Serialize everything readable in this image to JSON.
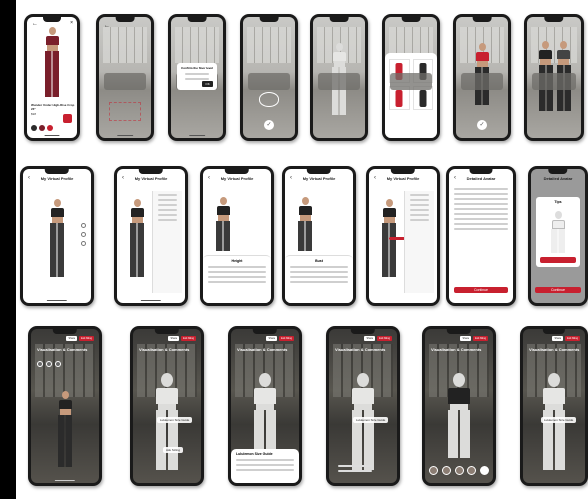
{
  "row1": {
    "product_title": "Wunder Under High-Rise Crop 23\"",
    "price": "$98",
    "dialog_title": "Confirm the floor level",
    "dialog_ok": "OK"
  },
  "row2": {
    "profile_title": "My Virtual Profile",
    "detailed_avatar_title": "Detailed Avatar",
    "continue_label": "Continue",
    "tips_label": "Tips",
    "height_label": "Height",
    "bust_label": "Bust"
  },
  "row3": {
    "overlay_title": "Visualisation & Comments",
    "chip_a": "Share",
    "chip_b": "Exit fitting",
    "size_label": "Lululemon Size Guide",
    "ask_label": "Ask Sizing"
  },
  "colors": {
    "accent": "#c8202f",
    "dark": "#1a1a1a"
  }
}
